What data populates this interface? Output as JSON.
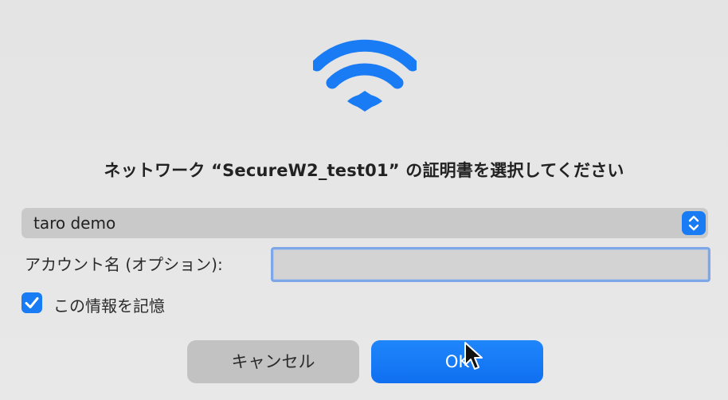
{
  "dialog": {
    "title": "ネットワーク “SecureW2_test01” の証明書を選択してください",
    "icon": "wifi-icon",
    "accent_color": "#1a7cf5"
  },
  "certificate_select": {
    "selected": "taro demo",
    "icon": "chevron-up-down-icon"
  },
  "account": {
    "label": "アカウント名 (オプション):",
    "value": "",
    "placeholder": ""
  },
  "remember": {
    "label": "この情報を記憶",
    "checked": true
  },
  "buttons": {
    "cancel_label": "キャンセル",
    "ok_label": "OK"
  }
}
